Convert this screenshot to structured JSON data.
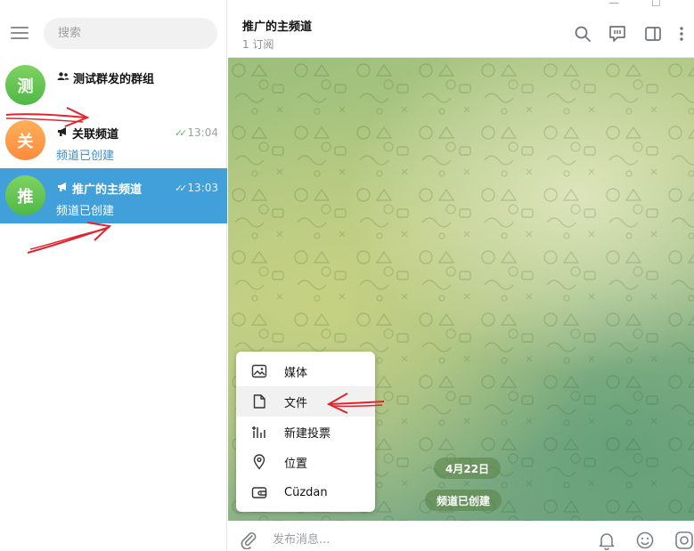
{
  "search": {
    "placeholder": "搜索"
  },
  "chats": [
    {
      "avatar_letter": "测",
      "title": "测试群发的群组",
      "type_icon": "group-icon",
      "time": "",
      "preview": ""
    },
    {
      "avatar_letter": "关",
      "title": "关联频道",
      "type_icon": "megaphone-icon",
      "time": "13:04",
      "preview": "频道已创建"
    },
    {
      "avatar_letter": "推",
      "title": "推广的主频道",
      "type_icon": "megaphone-icon",
      "time": "13:03",
      "preview": "频道已创建",
      "active": true
    }
  ],
  "header": {
    "title": "推广的主频道",
    "subtitle": "1 订阅"
  },
  "attach_menu": {
    "items": [
      {
        "label": "媒体",
        "icon": "image-icon"
      },
      {
        "label": "文件",
        "icon": "file-icon"
      },
      {
        "label": "新建投票",
        "icon": "poll-icon"
      },
      {
        "label": "位置",
        "icon": "location-icon"
      },
      {
        "label": "Cüzdan",
        "icon": "wallet-icon"
      }
    ]
  },
  "messages": {
    "date": "4月22日",
    "service": "频道已创建"
  },
  "composer": {
    "placeholder": "发布消息..."
  },
  "colors": {
    "accent": "#419fd9",
    "annotation_arrow": "#e0242b"
  }
}
